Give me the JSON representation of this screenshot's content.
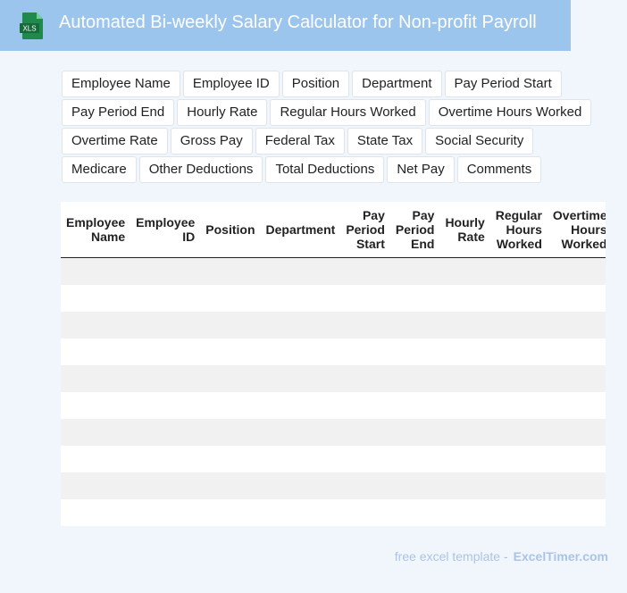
{
  "header": {
    "title": "Automated Bi-weekly Salary Calculator for Non-profit Payroll",
    "icon": "xls-file-icon",
    "icon_label": "XLS",
    "background_color": "#9cc5ee"
  },
  "tags": [
    "Employee Name",
    "Employee ID",
    "Position",
    "Department",
    "Pay Period Start",
    "Pay Period End",
    "Hourly Rate",
    "Regular Hours Worked",
    "Overtime Hours Worked",
    "Overtime Rate",
    "Gross Pay",
    "Federal Tax",
    "State Tax",
    "Social Security",
    "Medicare",
    "Other Deductions",
    "Total Deductions",
    "Net Pay",
    "Comments"
  ],
  "table": {
    "columns": [
      "Employee Name",
      "Employee ID",
      "Position",
      "Department",
      "Pay Period Start",
      "Pay Period End",
      "Hourly Rate",
      "Regular Hours Worked",
      "Overtime Hours Worked"
    ],
    "row_count": 10
  },
  "footer": {
    "lead": "free excel template -",
    "brand": "ExcelTimer.com"
  }
}
